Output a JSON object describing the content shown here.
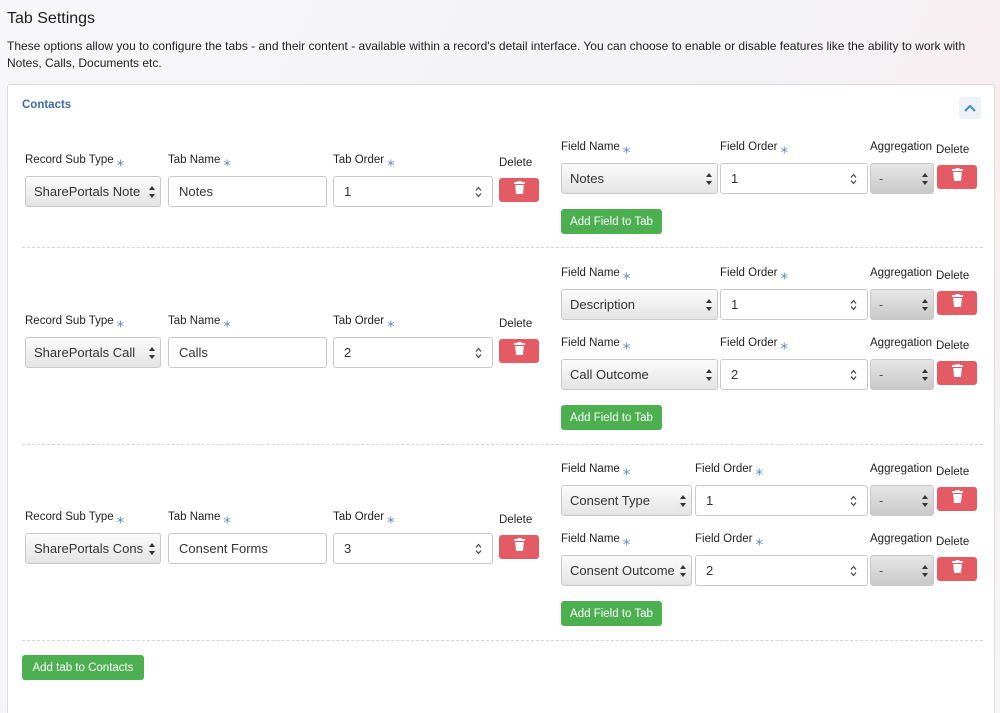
{
  "page": {
    "title": "Tab Settings",
    "description": "These options allow you to configure the tabs - and their content - available within a record's detail interface. You can choose to enable or disable features like the ability to work with Notes, Calls, Documents etc."
  },
  "card": {
    "title": "Contacts",
    "collapse_icon": "chevron-up-icon"
  },
  "labels": {
    "record_sub_type": "Record Sub Type",
    "tab_name": "Tab Name",
    "tab_order": "Tab Order",
    "delete": "Delete",
    "field_name": "Field Name",
    "field_order": "Field Order",
    "aggregation": "Aggregation",
    "required_mark": "⁎"
  },
  "tabs": [
    {
      "record_sub_type": "SharePortals Note",
      "tab_name": "Notes",
      "tab_order": "1",
      "fields": [
        {
          "field_name": "Notes",
          "field_order": "1",
          "aggregation": "-"
        }
      ],
      "add_field_label": "Add Field to Tab"
    },
    {
      "record_sub_type": "SharePortals Call",
      "tab_name": "Calls",
      "tab_order": "2",
      "fields": [
        {
          "field_name": "Description",
          "field_order": "1",
          "aggregation": "-"
        },
        {
          "field_name": "Call Outcome",
          "field_order": "2",
          "aggregation": "-"
        }
      ],
      "add_field_label": "Add Field to Tab"
    },
    {
      "record_sub_type": "SharePortals Cons",
      "tab_name": "Consent Forms",
      "tab_order": "3",
      "fields": [
        {
          "field_name": "Consent Type",
          "field_order": "1",
          "aggregation": "-"
        },
        {
          "field_name": "Consent Outcome",
          "field_order": "2",
          "aggregation": "-"
        }
      ],
      "add_field_label": "Add Field to Tab"
    }
  ],
  "add_tab_label": "Add tab to Contacts",
  "colors": {
    "accent_blue": "#3a6aa8",
    "required_blue": "#5b86c8",
    "delete_red": "#e45b64",
    "add_green": "#4caf50"
  }
}
